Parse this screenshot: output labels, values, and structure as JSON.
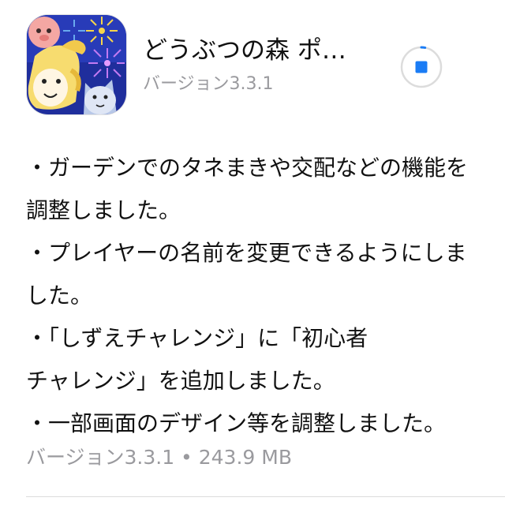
{
  "app": {
    "name": "どうぶつの森 ポ…",
    "version_label": "バージョン3.3.1",
    "icon": "animal-crossing-pocket-camp-icon",
    "accent_color": "#1a7cf5"
  },
  "download": {
    "icon": "stop-download-icon",
    "progress_fraction": 0.03
  },
  "release_notes": {
    "lines": [
      "・ガーデンでのタネまきや交配などの機能を",
      "調整しました。",
      "・プレイヤーの名前を変更できるようにしま",
      "した。",
      "・「しずえチャレンジ」に「初心者",
      "チャレンジ」を追加しました。",
      "・一部画面のデザイン等を調整しました。"
    ]
  },
  "footer": {
    "version_size": "バージョン3.3.1 • 243.9 MB"
  }
}
